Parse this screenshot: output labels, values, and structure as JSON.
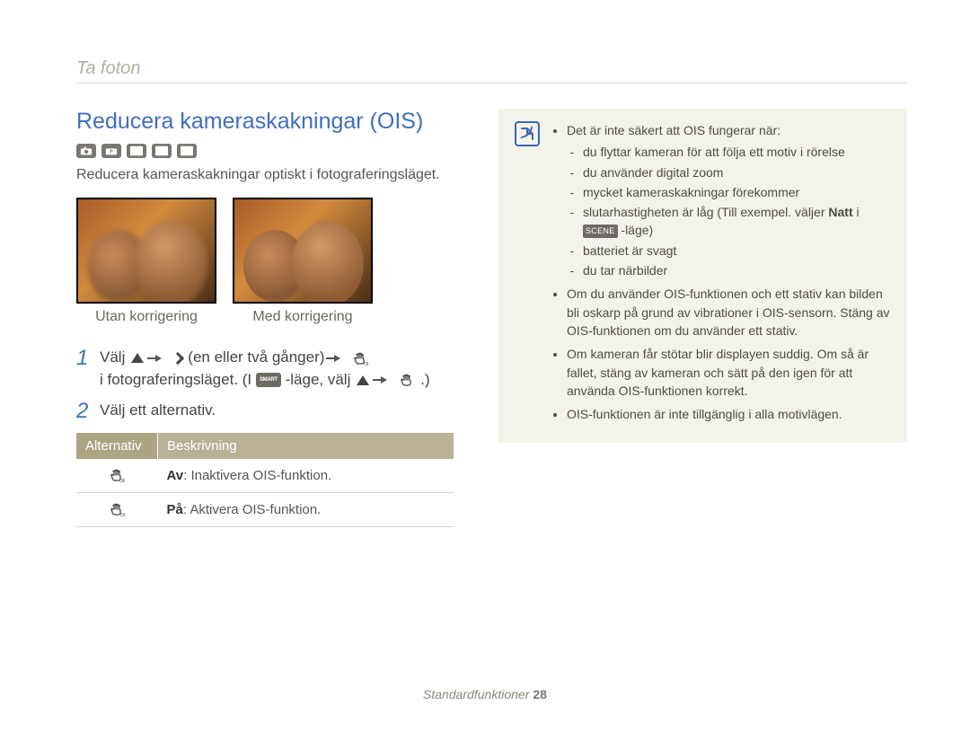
{
  "section": "Ta foton",
  "heading": "Reducera kameraskakningar (OIS)",
  "mode_icons": [
    "camera-icon",
    "camera-p-icon",
    "scene-icon",
    "movie-icon",
    "hd-movie-icon"
  ],
  "intro": "Reducera kameraskakningar optiskt i fotograferingsläget.",
  "photos": {
    "left_caption": "Utan korrigering",
    "right_caption": "Med korrigering"
  },
  "steps": {
    "one": {
      "num": "1",
      "part_a": "Välj ",
      "part_b": " (en eller två gånger) ",
      "part_c": "i fotograferingsläget. (I ",
      "part_d": " -läge, välj ",
      "part_e": ".)"
    },
    "two": {
      "num": "2",
      "text": "Välj ett alternativ."
    }
  },
  "options_table": {
    "headers": [
      "Alternativ",
      "Beskrivning"
    ],
    "rows": [
      {
        "icon": "ois-off-icon",
        "label": "Av",
        "desc": ": Inaktivera OIS-funktion."
      },
      {
        "icon": "ois-on-icon",
        "label": "På",
        "desc": ": Aktivera OIS-funktion."
      }
    ]
  },
  "note": {
    "bullets": [
      {
        "text": "Det är inte säkert att OIS fungerar när:",
        "sub": [
          "du flyttar kameran för att följa ett motiv i rörelse",
          "du använder digital zoom",
          "mycket kameraskakningar förekommer",
          {
            "pre": "slutarhastigheten är låg (Till exempel. väljer ",
            "bold": "Natt",
            "mid": " i ",
            "chip": "SCENE",
            "post": " -läge)"
          },
          "batteriet är svagt",
          "du tar närbilder"
        ]
      },
      {
        "text": "Om du använder OIS-funktionen och ett stativ kan bilden bli oskarp på grund av vibrationer i OIS-sensorn. Stäng av OIS-funktionen om du använder ett stativ."
      },
      {
        "text": "Om kameran får stötar blir displayen suddig. Om så är fallet, stäng av kameran och sätt på den igen för att använda OIS-funktionen korrekt."
      },
      {
        "text": "OIS-funktionen är inte tillgänglig i alla motivlägen."
      }
    ]
  },
  "footer": {
    "label": "Standardfunktioner",
    "page": "28"
  }
}
